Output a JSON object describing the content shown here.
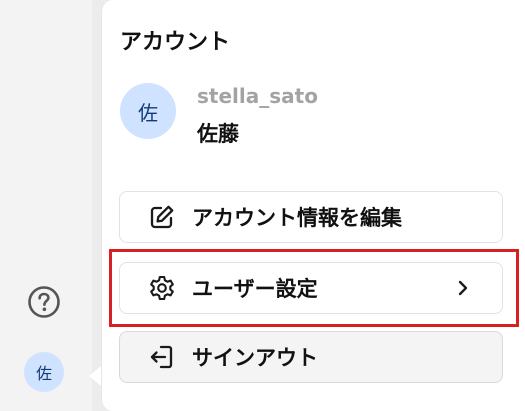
{
  "rail": {
    "help_icon": "question-circle-icon",
    "avatar_initial": "佐"
  },
  "account": {
    "title": "アカウント",
    "avatar_initial": "佐",
    "username": "stella_sato",
    "display_name": "佐藤"
  },
  "menu": {
    "edit_account": {
      "label": "アカウント情報を編集",
      "icon": "edit-icon"
    },
    "user_settings": {
      "label": "ユーザー設定",
      "icon": "gear-icon",
      "trailing_icon": "chevron-right-icon"
    },
    "sign_out": {
      "label": "サインアウト",
      "icon": "sign-out-icon"
    }
  },
  "colors": {
    "highlight": "#d81f26",
    "avatar_bg": "#cfe2ff",
    "avatar_text": "#123a78",
    "username_text": "#a3a3a3"
  }
}
